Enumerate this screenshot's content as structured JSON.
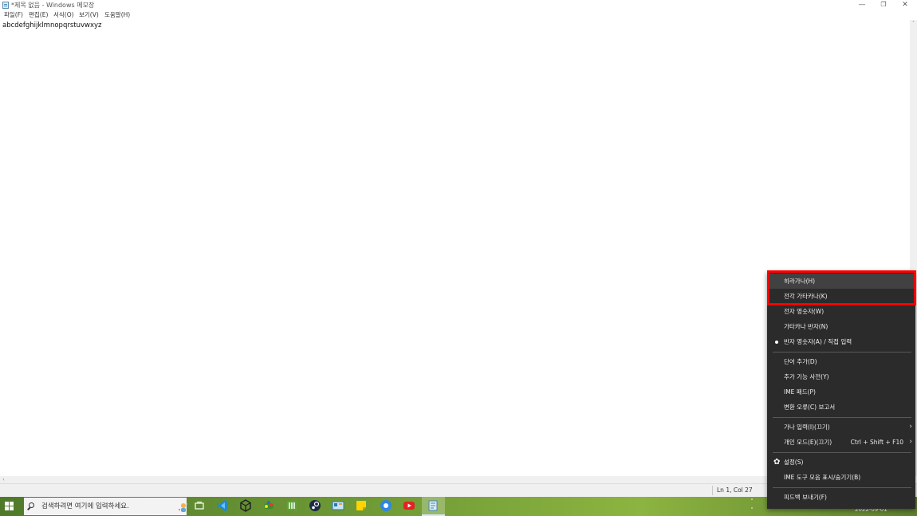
{
  "window": {
    "title": "*제목 없음 - Windows 메모장",
    "minimize": "—",
    "restore": "❐",
    "close": "✕"
  },
  "menu": [
    "파일(F)",
    "편집(E)",
    "서식(O)",
    "보기(V)",
    "도움말(H)"
  ],
  "editor": {
    "content": "abcdefghijklmnopqrstuvwxyz"
  },
  "scrollbar": {
    "left": "‹",
    "right": "›",
    "up": "˄",
    "down": "˅"
  },
  "status": {
    "position": "Ln 1, Col 27"
  },
  "taskbar": {
    "search_placeholder": "검색하려면 여기에 입력하세요.",
    "date": "2022-09-01",
    "tray_up": "˄",
    "tray_down": "˅"
  },
  "ime_menu": {
    "items": [
      {
        "label": "히라가나(H)"
      },
      {
        "label": "전각 가타카나(K)"
      },
      {
        "label": "전자 영숫자(W)"
      },
      {
        "label": "가타카나 반자(N)"
      },
      {
        "label": "반자 영숫자(A) / 직접 입력",
        "selected": true
      },
      {
        "label": "단어 추가(D)"
      },
      {
        "label": "추가 기능 사전(Y)"
      },
      {
        "label": "IME 패드(P)"
      },
      {
        "label": "변환 오류(C) 보고서"
      },
      {
        "label": "가나 입력(I)(끄기)",
        "submenu": "›"
      },
      {
        "label": "개인 모드(E)(끄기)",
        "shortcut": "Ctrl + Shift + F10",
        "submenu": "›"
      },
      {
        "label": "설정(S)",
        "icon": "gear-icon",
        "glyph": "✿"
      },
      {
        "label": "IME 도구 모음 표시/숨기기(B)"
      },
      {
        "label": "피드백 보내기(F)"
      }
    ]
  },
  "colors": {
    "highlight": "#ff0000",
    "menu_bg": "#2b2b2b"
  }
}
